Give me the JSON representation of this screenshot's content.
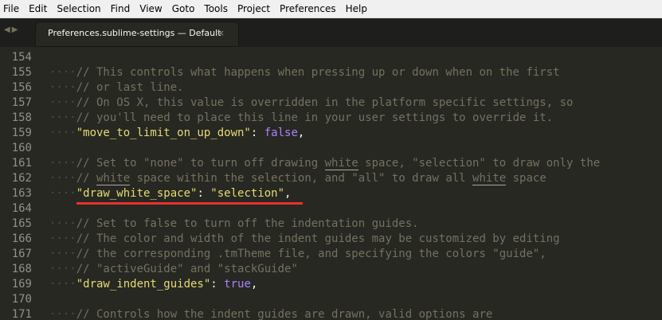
{
  "menu": [
    "File",
    "Edit",
    "Selection",
    "Find",
    "View",
    "Goto",
    "Tools",
    "Project",
    "Preferences",
    "Help"
  ],
  "tab": {
    "title": "Preferences.sublime-settings — Default",
    "close": "×"
  },
  "nav": {
    "back": "◀",
    "forward": "▶"
  },
  "gutter": {
    "indent_guides": "····"
  },
  "lines": [
    {
      "num": "154",
      "content": []
    },
    {
      "num": "155",
      "content": [
        {
          "type": "cm",
          "text": "// This controls what happens when pressing up or down when on the first"
        }
      ]
    },
    {
      "num": "156",
      "content": [
        {
          "type": "cm",
          "text": "// or last line."
        }
      ]
    },
    {
      "num": "157",
      "content": [
        {
          "type": "cm",
          "text": "// On OS X, this value is overridden in the platform specific settings, so"
        }
      ]
    },
    {
      "num": "158",
      "content": [
        {
          "type": "cm",
          "text": "// you'll need to place this line in your user settings to override it."
        }
      ]
    },
    {
      "num": "159",
      "content": [
        {
          "type": "str",
          "text": "\"move_to_limit_on_up_down\""
        },
        {
          "type": "plain",
          "text": ": "
        },
        {
          "type": "kw",
          "text": "false"
        },
        {
          "type": "plain",
          "text": ","
        }
      ]
    },
    {
      "num": "160",
      "content": []
    },
    {
      "num": "161",
      "content": [
        {
          "type": "cm",
          "text": "// Set to \"none\" to turn off drawing "
        },
        {
          "type": "cm-ul",
          "text": "white"
        },
        {
          "type": "cm",
          "text": " space, \"selection\" to draw only the"
        }
      ]
    },
    {
      "num": "162",
      "content": [
        {
          "type": "cm",
          "text": "// "
        },
        {
          "type": "cm-ul",
          "text": "white"
        },
        {
          "type": "cm",
          "text": " space within the selection, and \"all\" to draw all "
        },
        {
          "type": "cm-ul",
          "text": "white"
        },
        {
          "type": "cm",
          "text": " space"
        }
      ]
    },
    {
      "num": "163",
      "content": [
        {
          "type": "str",
          "text": "\"draw_white_space\""
        },
        {
          "type": "plain",
          "text": ": "
        },
        {
          "type": "str",
          "text": "\"selection\""
        },
        {
          "type": "plain",
          "text": ","
        }
      ]
    },
    {
      "num": "164",
      "content": []
    },
    {
      "num": "165",
      "content": [
        {
          "type": "cm",
          "text": "// Set to false to turn off the indentation guides."
        }
      ]
    },
    {
      "num": "166",
      "content": [
        {
          "type": "cm",
          "text": "// The color and width of the indent guides may be customized by editing"
        }
      ]
    },
    {
      "num": "167",
      "content": [
        {
          "type": "cm",
          "text": "// the corresponding .tmTheme file, and specifying the colors \"guide\","
        }
      ]
    },
    {
      "num": "168",
      "content": [
        {
          "type": "cm",
          "text": "// \"activeGuide\" and \"stackGuide\""
        }
      ]
    },
    {
      "num": "169",
      "content": [
        {
          "type": "str",
          "text": "\"draw_indent_guides\""
        },
        {
          "type": "plain",
          "text": ": "
        },
        {
          "type": "kw",
          "text": "true"
        },
        {
          "type": "plain",
          "text": ","
        }
      ]
    },
    {
      "num": "170",
      "content": []
    },
    {
      "num": "171",
      "content": [
        {
          "type": "cm",
          "text": "// Controls how the indent guides are drawn, valid options are"
        }
      ]
    }
  ],
  "colors": {
    "background": "#272822",
    "comment": "#75715e",
    "string": "#e6db74",
    "constant": "#ae81ff",
    "highlight_underline": "#e8322c"
  }
}
